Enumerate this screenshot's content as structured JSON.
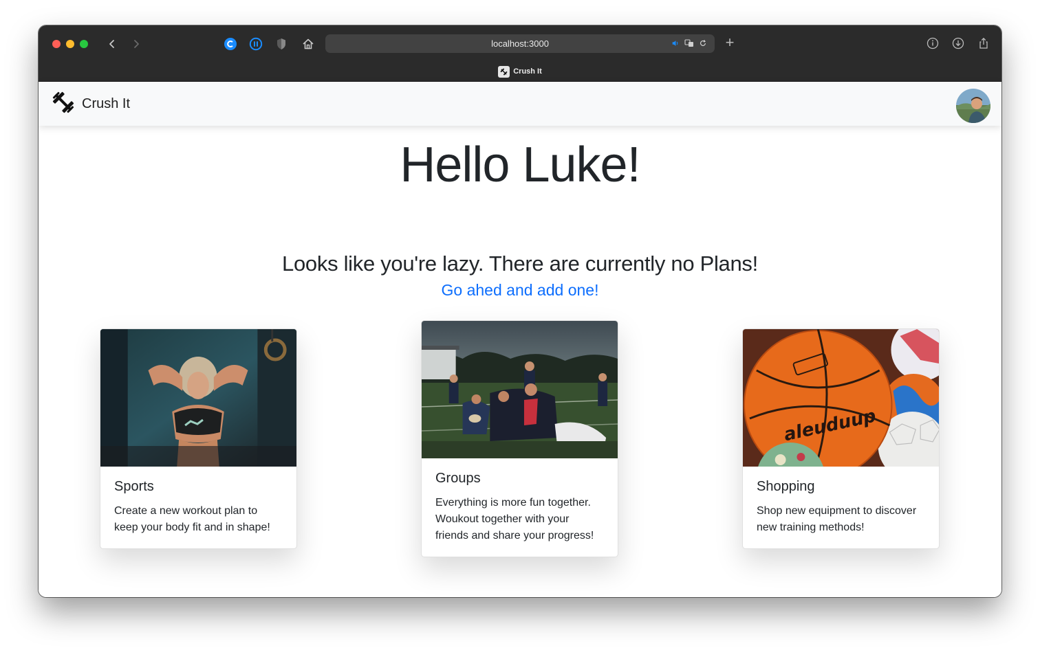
{
  "browser": {
    "url": "localhost:3000",
    "tab_title": "Crush It"
  },
  "nav": {
    "brand": "Crush It"
  },
  "hero": {
    "greeting_prefix": "Hello ",
    "greeting_name": "Luke!",
    "empty_message": "Looks like you're lazy. There are currently no Plans!",
    "add_link": "Go ahed and add one!"
  },
  "cards": [
    {
      "title": "Sports",
      "text": "Create a new workout plan to keep your body fit and in shape!"
    },
    {
      "title": "Groups",
      "text": "Everything is more fun together. Woukout together with your friends and share your progress!"
    },
    {
      "title": "Shopping",
      "text": "Shop new equipment to discover new training methods!"
    }
  ],
  "colors": {
    "link": "#0d6efd",
    "navbar_bg": "#f8f9fa",
    "chrome_bg": "#2b2b2b"
  }
}
